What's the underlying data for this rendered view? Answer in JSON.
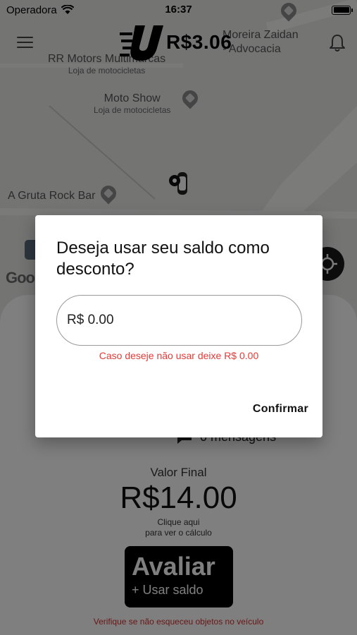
{
  "status_bar": {
    "carrier": "Operadora",
    "time": "16:37"
  },
  "header": {
    "balance": "R$3.06"
  },
  "map": {
    "pois": [
      {
        "name": "Moreira Zaidan\n- Advocacia",
        "sub": ""
      },
      {
        "name": "RR Motors Multimarcas",
        "sub": "Loja de motocicletas"
      },
      {
        "name": "Moto Show",
        "sub": "Loja de motocicletas"
      },
      {
        "name": "A Gruta Rock Bar",
        "sub": ""
      }
    ],
    "google_logo": "Goo"
  },
  "sheet": {
    "messages_label": "0 mensagens",
    "final_label": "Valor Final",
    "final_value": "R$14.00",
    "calc_hint_line1": "Clique aqui",
    "calc_hint_line2": "para ver o cálculo",
    "rate_button_title": "Avaliar",
    "rate_button_sub": "+ Usar saldo",
    "forgot_warning": "Verifique se não esqueceu objetos no veículo"
  },
  "dialog": {
    "title": "Deseja usar seu saldo como desconto?",
    "input_value": "R$ 0.00",
    "hint": "Caso deseje não usar deixe R$ 0.00",
    "confirm_label": "Confirmar"
  },
  "colors": {
    "hint_red": "#e53935",
    "warning_red": "#d32f2f",
    "button_black": "#000000"
  }
}
